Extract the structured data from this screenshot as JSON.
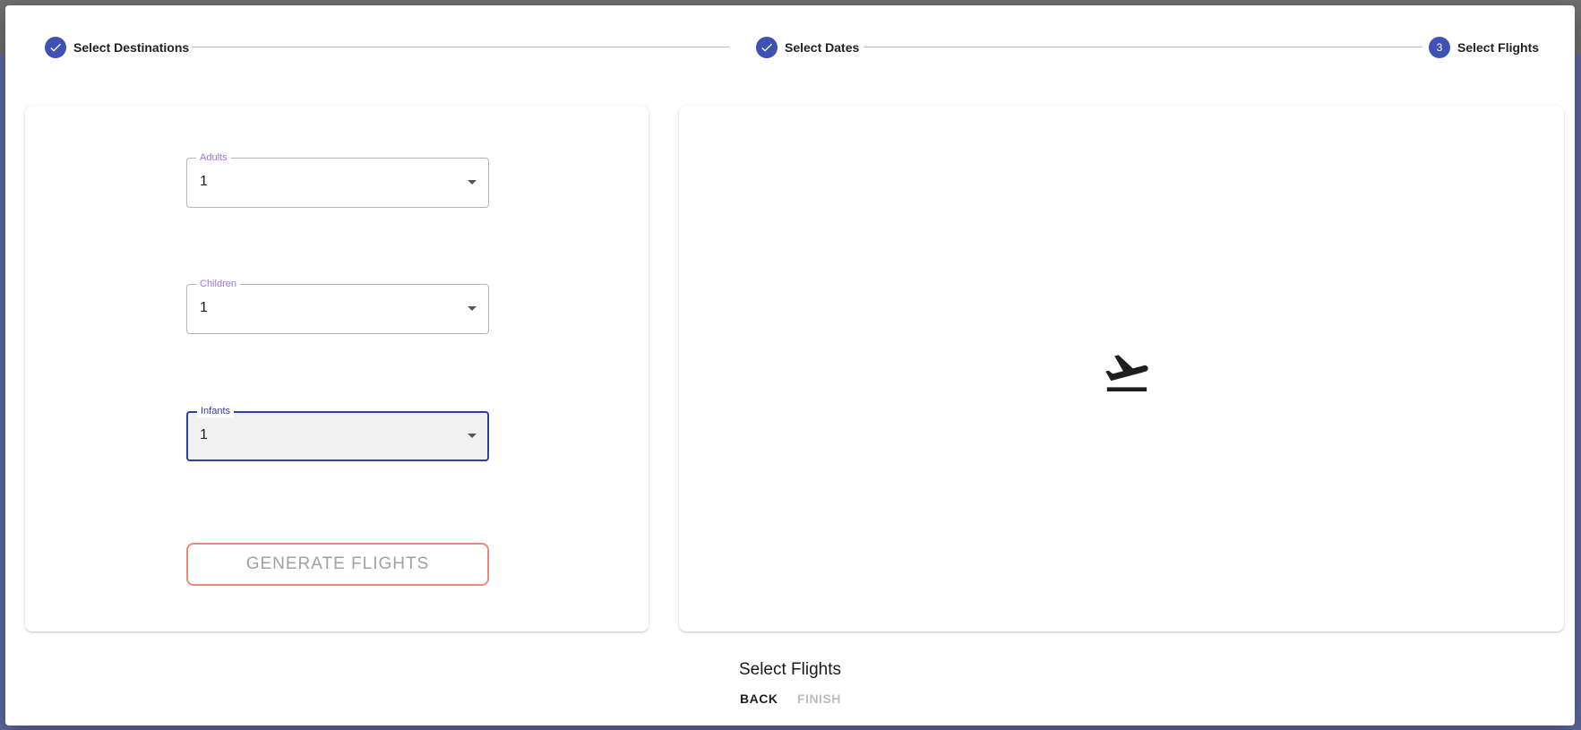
{
  "stepper": {
    "steps": [
      {
        "label": "Select Destinations",
        "state": "completed",
        "icon": "check-icon"
      },
      {
        "label": "Select Dates",
        "state": "completed",
        "icon": "check-icon"
      },
      {
        "label": "Select Flights",
        "state": "active",
        "number": "3"
      }
    ]
  },
  "form": {
    "adults": {
      "label": "Adults",
      "value": "1"
    },
    "children": {
      "label": "Children",
      "value": "1"
    },
    "infants": {
      "label": "Infants",
      "value": "1"
    },
    "generate_button": "GENERATE FLIGHTS"
  },
  "results": {
    "icon": "flight-takeoff-icon"
  },
  "footer": {
    "title": "Select Flights",
    "back_label": "BACK",
    "finish_label": "FINISH"
  },
  "colors": {
    "primary": "#3f51b5",
    "accent_label": "#9575e6",
    "button_border": "#ee8a7b"
  }
}
